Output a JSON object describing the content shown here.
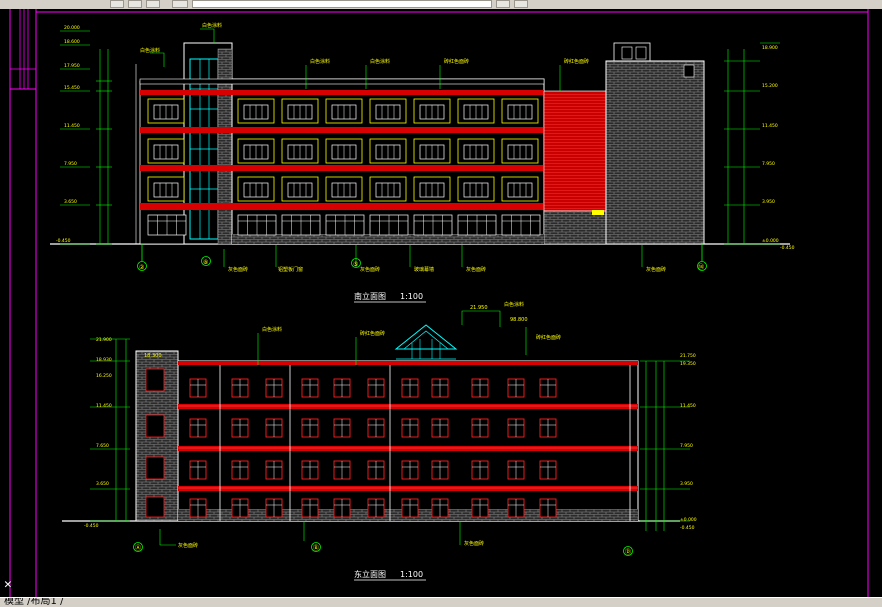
{
  "statusbar": {
    "layout_tab": "模型 /布局1 /"
  },
  "south_elevation": {
    "title": "南立面图",
    "scale": "1:100",
    "grid_left": "②",
    "grid_right": "⑭",
    "grid_mid_a": "⑧",
    "grid_mid_b": "⑤"
  },
  "east_elevation": {
    "title": "东立面图",
    "scale": "1:100",
    "grid_left": "Ⓐ",
    "grid_right": "Ⓓ",
    "grid_mid": "Ⓑ"
  },
  "colors": {
    "wall_red": "#d80000",
    "brick_gray": "#808080",
    "line_white": "#ffffff",
    "dim_green": "#00ff00",
    "label_yellow": "#ffff00",
    "glass_cyan": "#00ffff",
    "frame_magenta": "#ff00ff",
    "window_red": "#ff2020"
  }
}
